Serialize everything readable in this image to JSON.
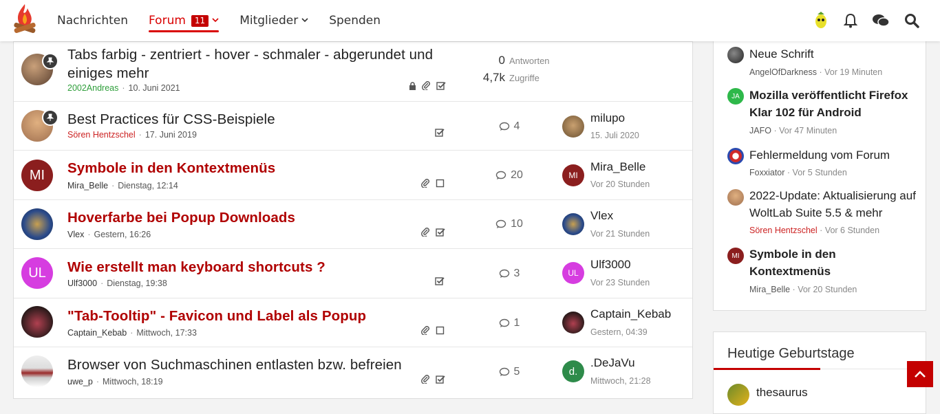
{
  "nav": {
    "items": [
      {
        "label": "Nachrichten"
      },
      {
        "label": "Forum",
        "badge": "11"
      },
      {
        "label": "Mitglieder"
      },
      {
        "label": "Spenden"
      }
    ]
  },
  "topics": [
    {
      "title": "Tabs farbig - zentriert - hover - schmaler - abgerundet und einiges mehr",
      "author": "2002Andreas",
      "date": "10. Juni 2021",
      "answers": "0",
      "answers_label": "Antworten",
      "views": "4,7k",
      "views_label": "Zugriffe"
    },
    {
      "title": "Best Practices für CSS-Beispiele",
      "author": "Sören Hentzschel",
      "date": "17. Juni 2019",
      "replies": "4",
      "last_user": "milupo",
      "last_time": "15. Juli 2020"
    },
    {
      "title": "Symbole in den Kontextmenüs",
      "author": "Mira_Belle",
      "date": "Dienstag, 12:14",
      "replies": "20",
      "last_user": "Mira_Belle",
      "last_time": "Vor 20 Stunden",
      "avatar_text": "MI"
    },
    {
      "title": "Hoverfarbe bei Popup Downloads",
      "author": "Vlex",
      "date": "Gestern, 16:26",
      "replies": "10",
      "last_user": "Vlex",
      "last_time": "Vor 21 Stunden"
    },
    {
      "title": "Wie erstellt man keyboard shortcuts ?",
      "author": "Ulf3000",
      "date": "Dienstag, 19:38",
      "replies": "3",
      "last_user": "Ulf3000",
      "last_time": "Vor 23 Stunden",
      "avatar_text": "UL"
    },
    {
      "title": "\"Tab-Tooltip\" - Favicon und Label als Popup",
      "author": "Captain_Kebab",
      "date": "Mittwoch, 17:33",
      "replies": "1",
      "last_user": "Captain_Kebab",
      "last_time": "Gestern, 04:39"
    },
    {
      "title": "Browser von Suchmaschinen entlasten bzw. befreien",
      "author": "uwe_p",
      "date": "Mittwoch, 18:19",
      "replies": "5",
      "last_user": ".DeJaVu",
      "last_time": "Mittwoch, 21:28",
      "last_avatar_text": "d."
    }
  ],
  "sidebar": {
    "items": [
      {
        "title": "Neue Schrift",
        "author": "AngelOfDarkness",
        "time": "Vor 19 Minuten"
      },
      {
        "title": "Mozilla veröffentlicht Firefox Klar 102 für Android",
        "author": "JAFO",
        "time": "Vor 47 Minuten",
        "avatar_text": "JA"
      },
      {
        "title": "Fehlermeldung vom Forum",
        "author": "Foxxiator",
        "time": "Vor 5 Stunden"
      },
      {
        "title": "2022-Update: Aktualisierung auf WoltLab Suite 5.5 & mehr",
        "author": "Sören Hentzschel",
        "time": "Vor 6 Stunden"
      },
      {
        "title": "Symbole in den Kontextmenüs",
        "author": "Mira_Belle",
        "time": "Vor 20 Stunden",
        "avatar_text": "MI"
      }
    ],
    "birthdays_title": "Heutige Geburtstage",
    "birthday_user": "thesaurus"
  },
  "meta_sep": "·",
  "colors": {
    "accent": "#c40000",
    "unread_title": "#b00000"
  }
}
